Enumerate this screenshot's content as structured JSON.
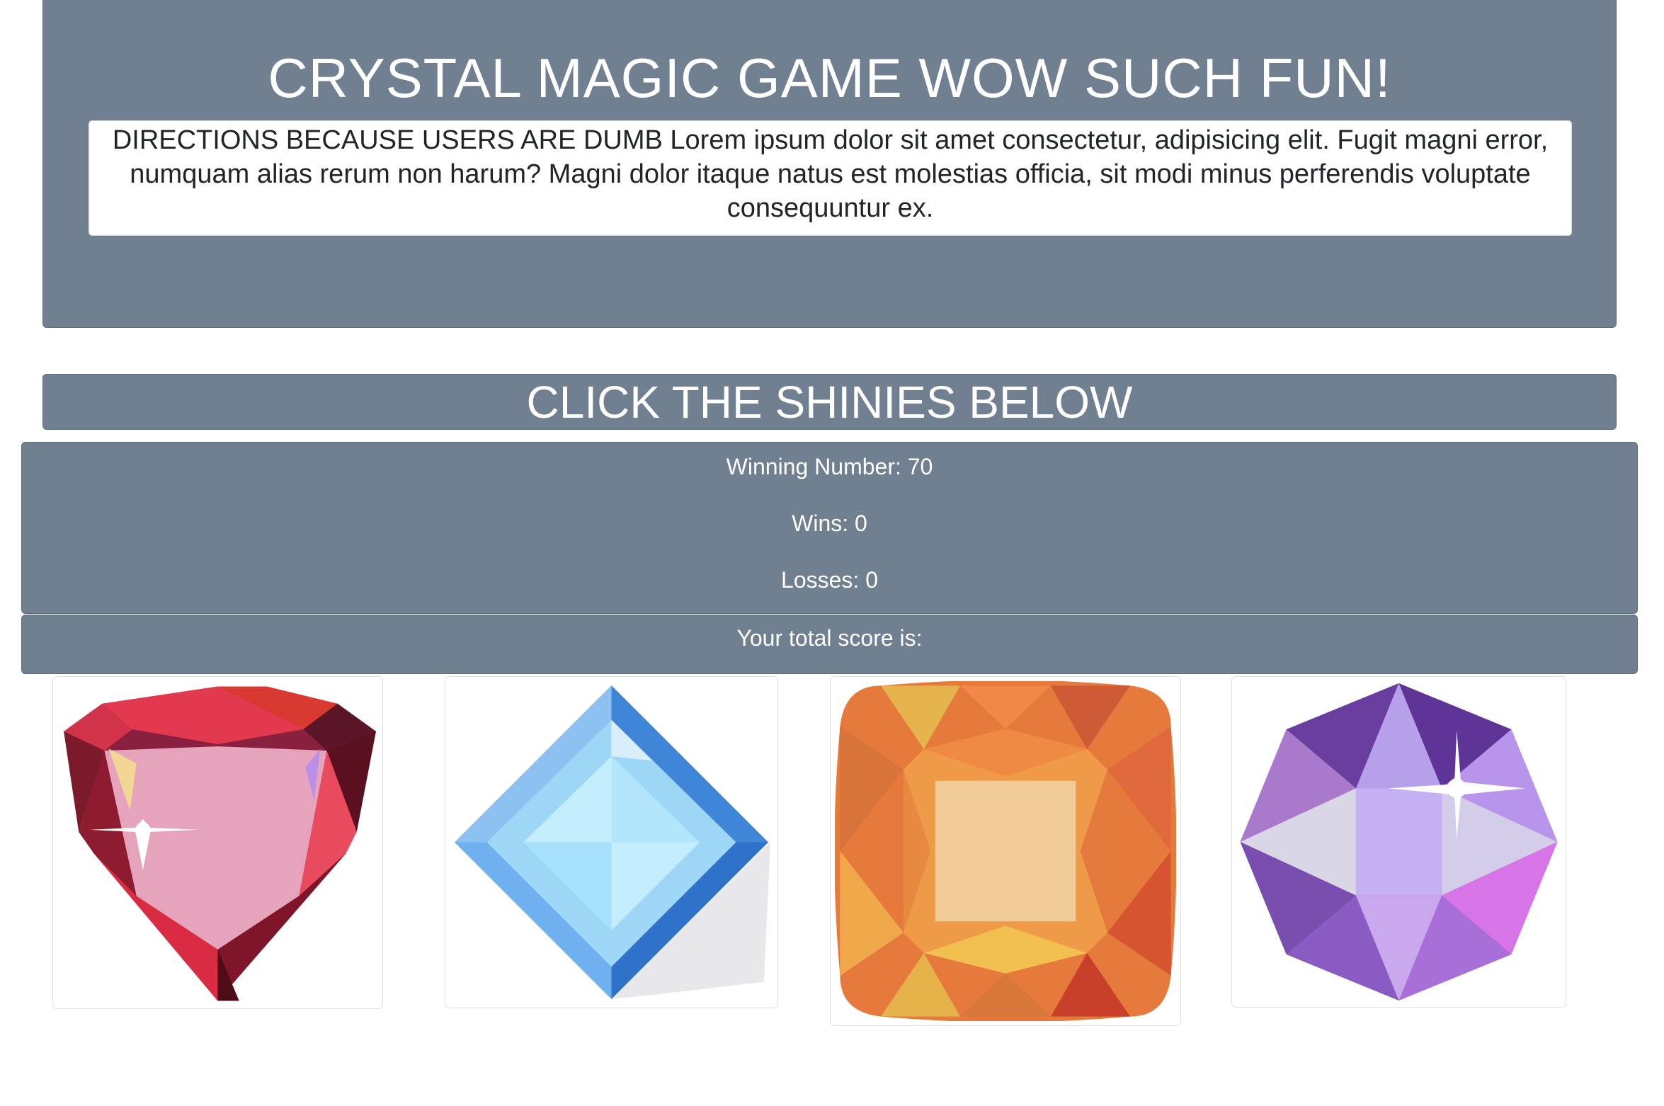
{
  "header": {
    "title": "CRYSTAL MAGIC GAME WOW SUCH FUN!",
    "directions": "DIRECTIONS BECAUSE USERS ARE DUMB Lorem ipsum dolor sit amet consectetur, adipisicing elit. Fugit magni error, numquam alias rerum non harum? Magni dolor itaque natus est molestias officia, sit modi minus perferendis voluptate consequuntur ex."
  },
  "banner": {
    "title": "CLICK THE SHINIES BELOW"
  },
  "stats": {
    "winning_number": "Winning Number: 70",
    "wins": "Wins: 0",
    "losses": "Losses: 0"
  },
  "score": {
    "label": "Your total score is:"
  },
  "theme": {
    "panel_color": "#708090",
    "text_color": "#ffffff"
  },
  "crystals": [
    {
      "name": "red-trillion-crystal",
      "color": "#e0344a"
    },
    {
      "name": "blue-square-crystal",
      "color": "#7fb8ee"
    },
    {
      "name": "orange-cushion-crystal",
      "color": "#ec8a3c"
    },
    {
      "name": "purple-octagon-crystal",
      "color": "#a27ae0"
    }
  ]
}
